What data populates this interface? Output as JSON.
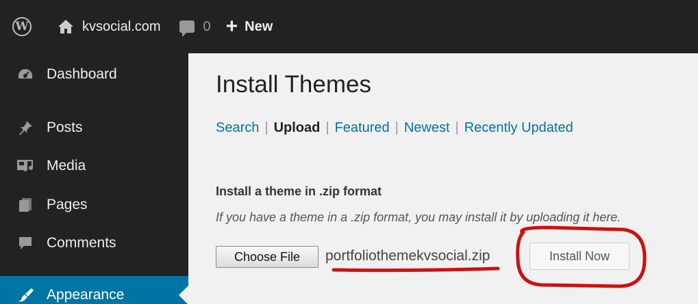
{
  "adminbar": {
    "site_name": "kvsocial.com",
    "comments_count": "0",
    "new_label": "New",
    "icons": [
      "wordpress-logo-icon",
      "home-icon",
      "comment-bubble-icon",
      "plus-icon"
    ]
  },
  "sidebar": {
    "items": [
      {
        "label": "Dashboard",
        "icon": "dashboard-icon"
      },
      {
        "label": "Posts",
        "icon": "pushpin-icon"
      },
      {
        "label": "Media",
        "icon": "media-icon"
      },
      {
        "label": "Pages",
        "icon": "pages-icon"
      },
      {
        "label": "Comments",
        "icon": "comment-icon"
      },
      {
        "label": "Appearance",
        "icon": "brush-icon",
        "active": true
      }
    ]
  },
  "main": {
    "title": "Install Themes",
    "subnav": {
      "search": "Search",
      "upload": "Upload",
      "featured": "Featured",
      "newest": "Newest",
      "recently_updated": "Recently Updated",
      "separator": "|"
    },
    "section_heading": "Install a theme in .zip format",
    "section_text": "If you have a theme in a .zip format, you may install it by uploading it here.",
    "choose_file_label": "Choose File",
    "file_name": "portfoliothemekvsocial.zip",
    "install_button_label": "Install Now"
  },
  "colors": {
    "adminbar_bg": "#222222",
    "active_menu": "#0074a2",
    "link": "#0074a2",
    "annotation": "#cc1111"
  }
}
